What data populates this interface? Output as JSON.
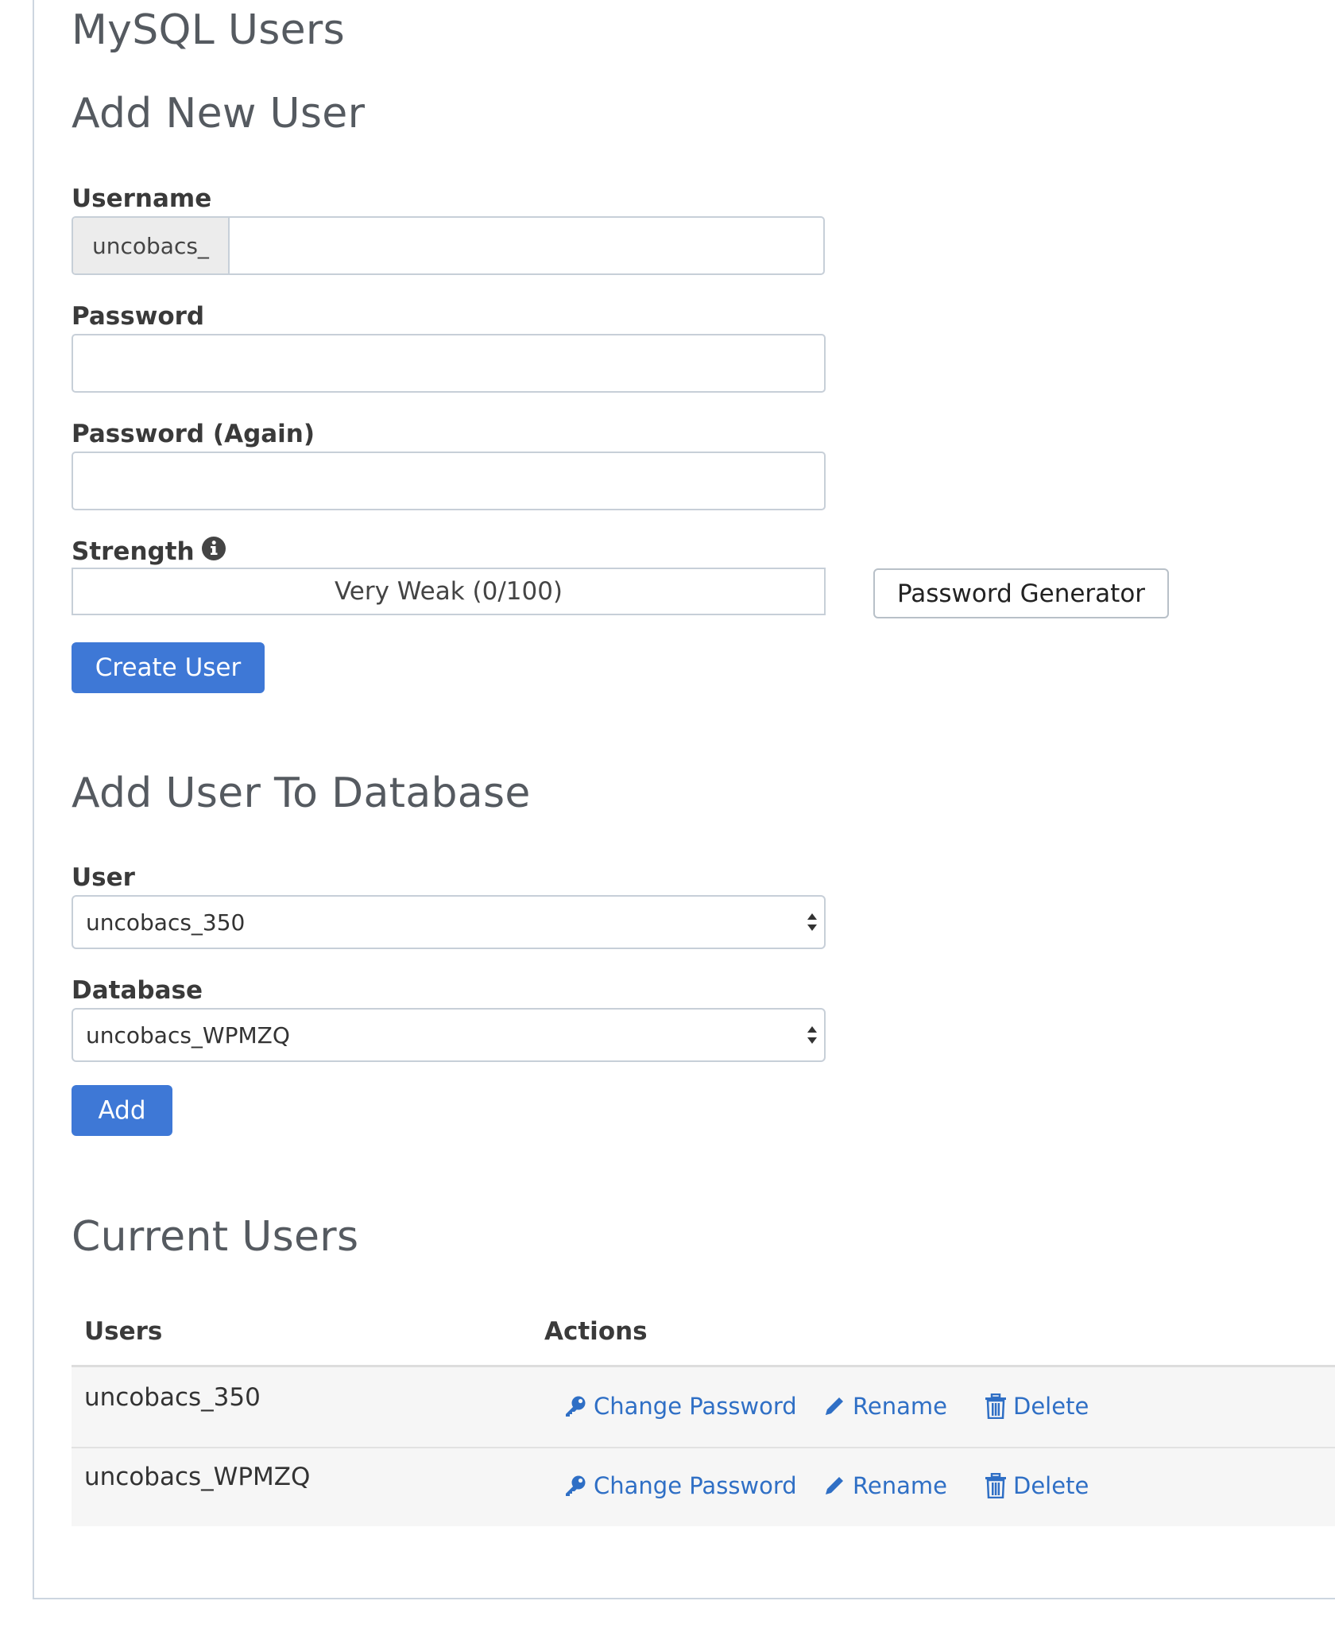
{
  "page": {
    "title": "MySQL Users"
  },
  "add_new_user": {
    "heading": "Add New User",
    "username": {
      "label": "Username",
      "prefix": "uncobacs_",
      "value": ""
    },
    "password": {
      "label": "Password",
      "value": ""
    },
    "password_again": {
      "label": "Password (Again)",
      "value": ""
    },
    "strength": {
      "label": "Strength",
      "meter_text": "Very Weak (0/100)",
      "score": 0
    },
    "generator_button": "Password Generator",
    "create_button": "Create User"
  },
  "add_user_to_database": {
    "heading": "Add User To Database",
    "user": {
      "label": "User",
      "selected": "uncobacs_350"
    },
    "database": {
      "label": "Database",
      "selected": "uncobacs_WPMZQ"
    },
    "add_button": "Add"
  },
  "current_users": {
    "heading": "Current Users",
    "columns": [
      "Users",
      "Actions"
    ],
    "rows": [
      {
        "user": "uncobacs_350",
        "actions": [
          "Change Password",
          "Rename",
          "Delete"
        ]
      },
      {
        "user": "uncobacs_WPMZQ",
        "actions": [
          "Change Password",
          "Rename",
          "Delete"
        ]
      }
    ]
  },
  "icons": {
    "info": "info-icon",
    "key": "key-icon",
    "pencil": "pencil-icon",
    "trash": "trash-icon",
    "select_arrows": "select-arrows-icon"
  },
  "colors": {
    "primary": "#3e78d6",
    "link": "#2f6fc5",
    "heading": "#555a60"
  }
}
